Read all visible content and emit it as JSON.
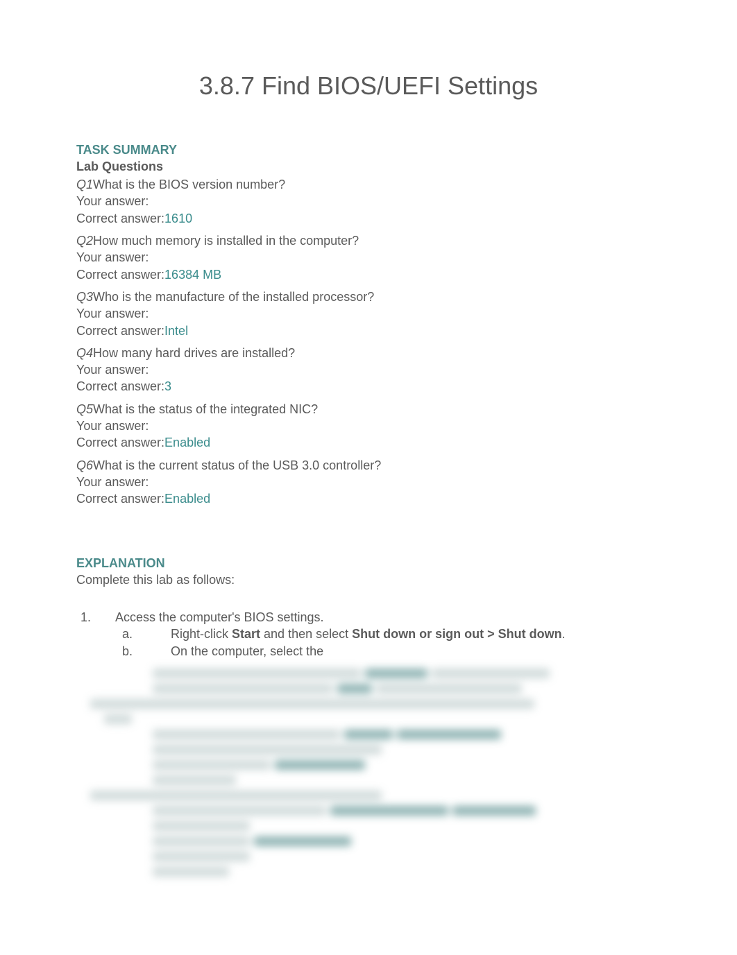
{
  "title": "3.8.7 Find BIOS/UEFI Settings",
  "task_summary_label": "TASK SUMMARY",
  "lab_questions_label": "Lab Questions",
  "your_answer_label": "Your answer:",
  "correct_answer_label": "Correct answer:",
  "questions": [
    {
      "label": "Q1",
      "text": "What is the BIOS version number?",
      "correct": "1610"
    },
    {
      "label": "Q2",
      "text": "How much memory is installed in the computer?",
      "correct": "16384 MB"
    },
    {
      "label": "Q3",
      "text": "Who is the manufacture of the installed processor?",
      "correct": "Intel"
    },
    {
      "label": "Q4",
      "text": "How many hard drives are installed?",
      "correct": "3"
    },
    {
      "label": "Q5",
      "text": "What is the status of the integrated NIC?",
      "correct": "Enabled"
    },
    {
      "label": "Q6",
      "text": "What is the current status of the USB 3.0 controller?",
      "correct": "Enabled"
    }
  ],
  "explanation_label": "EXPLANATION",
  "explanation_intro": "Complete this lab as follows:",
  "steps": {
    "step1": {
      "text": "Access the computer's BIOS settings.",
      "a_pre": "Right-click ",
      "a_bold1": "Start",
      "a_mid": " and then select ",
      "a_bold2": "Shut down or sign out > Shut down",
      "a_suffix": ".",
      "b_text": "On the computer, select the "
    }
  }
}
